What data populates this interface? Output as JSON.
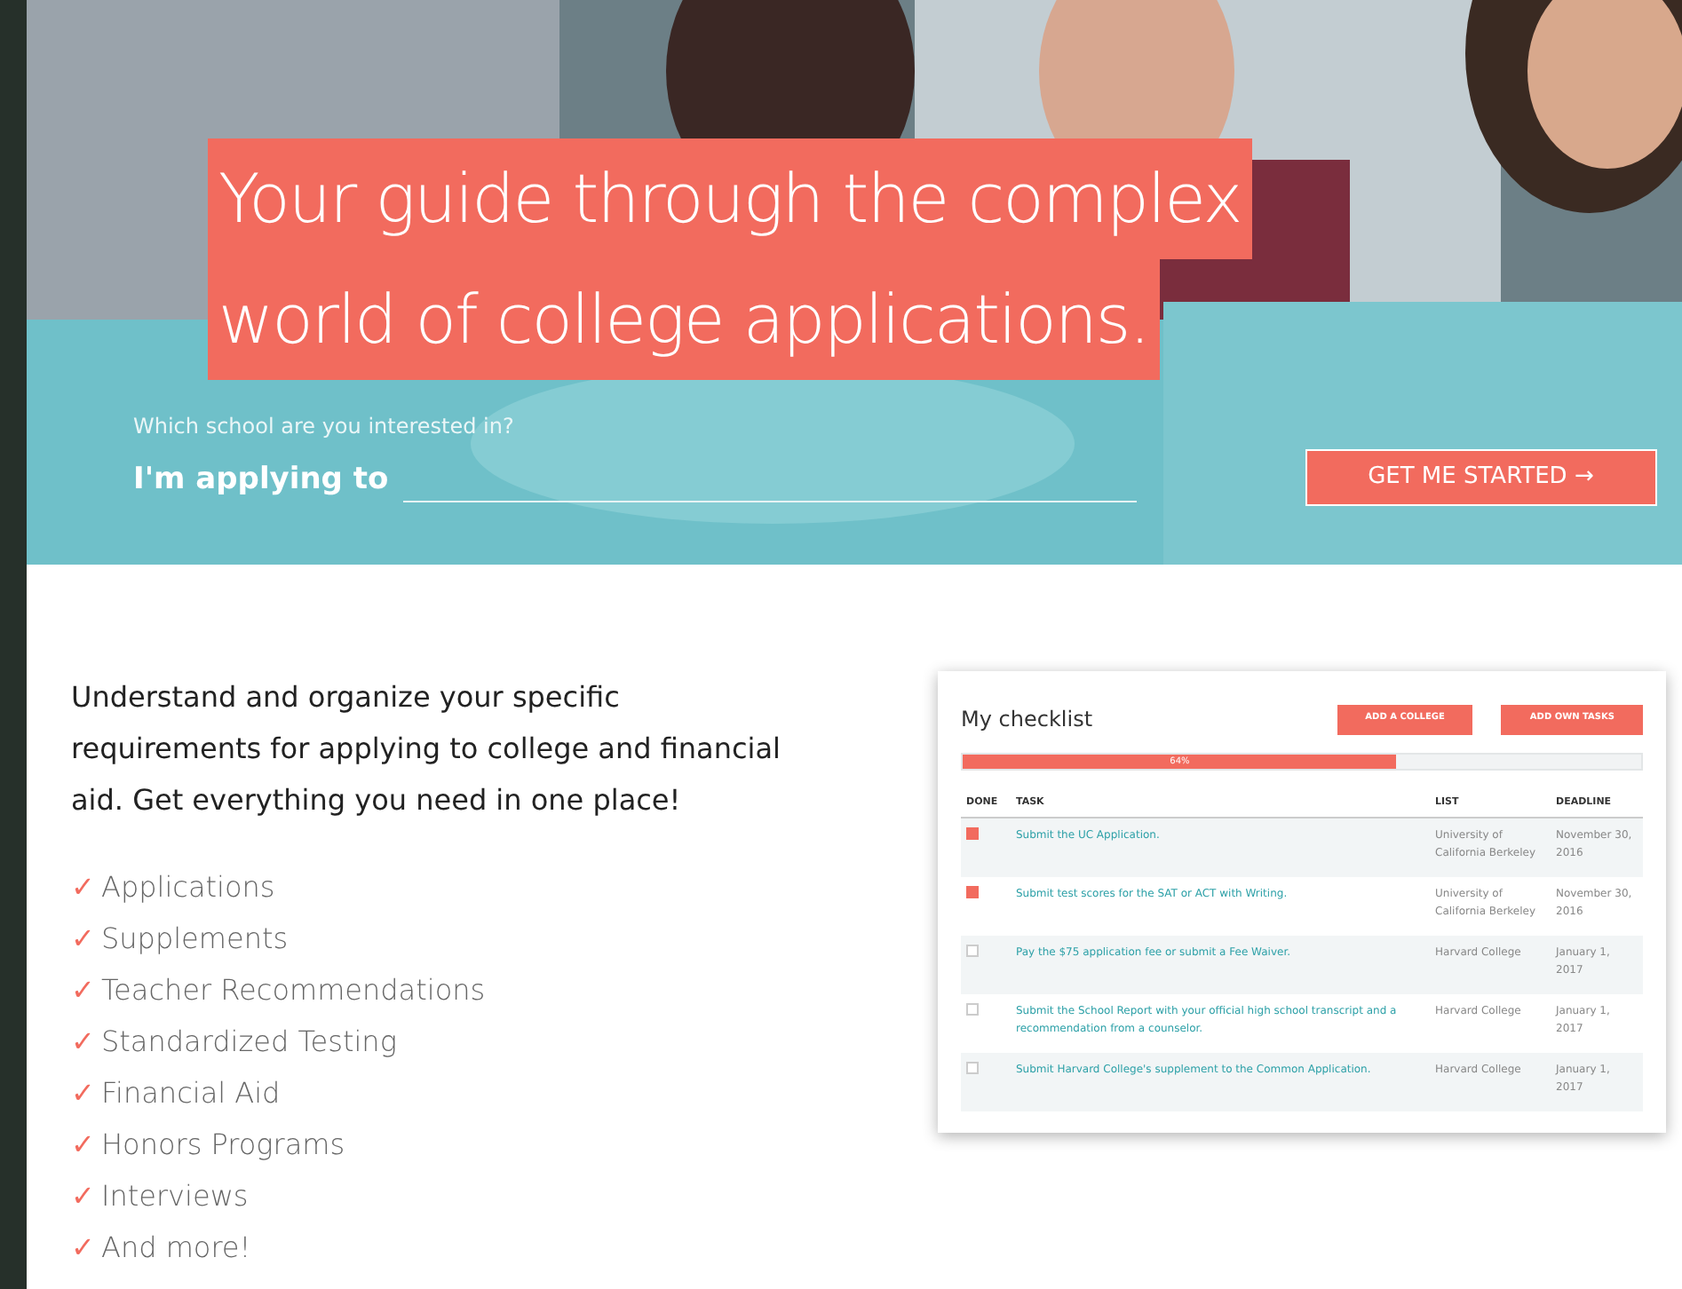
{
  "hero": {
    "kind": "picture",
    "headline": [
      "Your guide through the complex",
      "world of college applications."
    ],
    "form": {
      "hint": "Which school are you interested in?",
      "label": "I'm applying to",
      "button": "GET ME STARTED",
      "button_icon": "→"
    }
  },
  "intro": "Understand and organize your specific requirements for applying to college and financial aid. Get everything you need in one place!",
  "features": [
    {
      "mark": "✓",
      "text": "Applications"
    },
    {
      "mark": "✓",
      "text": "Supplements"
    },
    {
      "mark": "✓",
      "text": "Teacher Recommendations"
    },
    {
      "mark": "✓",
      "text": "Standardized Testing"
    },
    {
      "mark": "✓",
      "text": "Financial Aid"
    },
    {
      "mark": "✓",
      "text": "Honors Programs"
    },
    {
      "mark": "✓",
      "text": "Interviews"
    },
    {
      "mark": "✓",
      "text": "And more!"
    }
  ],
  "checklist": {
    "title": "My checklist",
    "buttons": [
      "ADD A COLLEGE",
      "ADD OWN TASKS"
    ],
    "progress": {
      "level": 0.64,
      "reading": "64%"
    },
    "columns": [
      "DONE",
      "TASK",
      "LIST",
      "DEADLINE"
    ],
    "rows": [
      {
        "checked": true,
        "task": "Submit the UC Application.",
        "list": "University of California Berkeley",
        "deadline": "November 30, 2016"
      },
      {
        "checked": true,
        "task": "Submit test scores for the SAT or ACT with Writing.",
        "list": "University of California Berkeley",
        "deadline": "November 30, 2016"
      },
      {
        "checked": false,
        "task": "Pay the $75 application fee or submit a Fee Waiver.",
        "list": "Harvard College",
        "deadline": "January 1, 2017"
      },
      {
        "checked": false,
        "task": "Submit the School Report with your official high school transcript and a recommendation from a counselor.",
        "list": "Harvard College",
        "deadline": "January 1, 2017"
      },
      {
        "checked": false,
        "task": "Submit Harvard College's supplement to the Common Application.",
        "list": "Harvard College",
        "deadline": "January 1, 2017"
      }
    ]
  }
}
